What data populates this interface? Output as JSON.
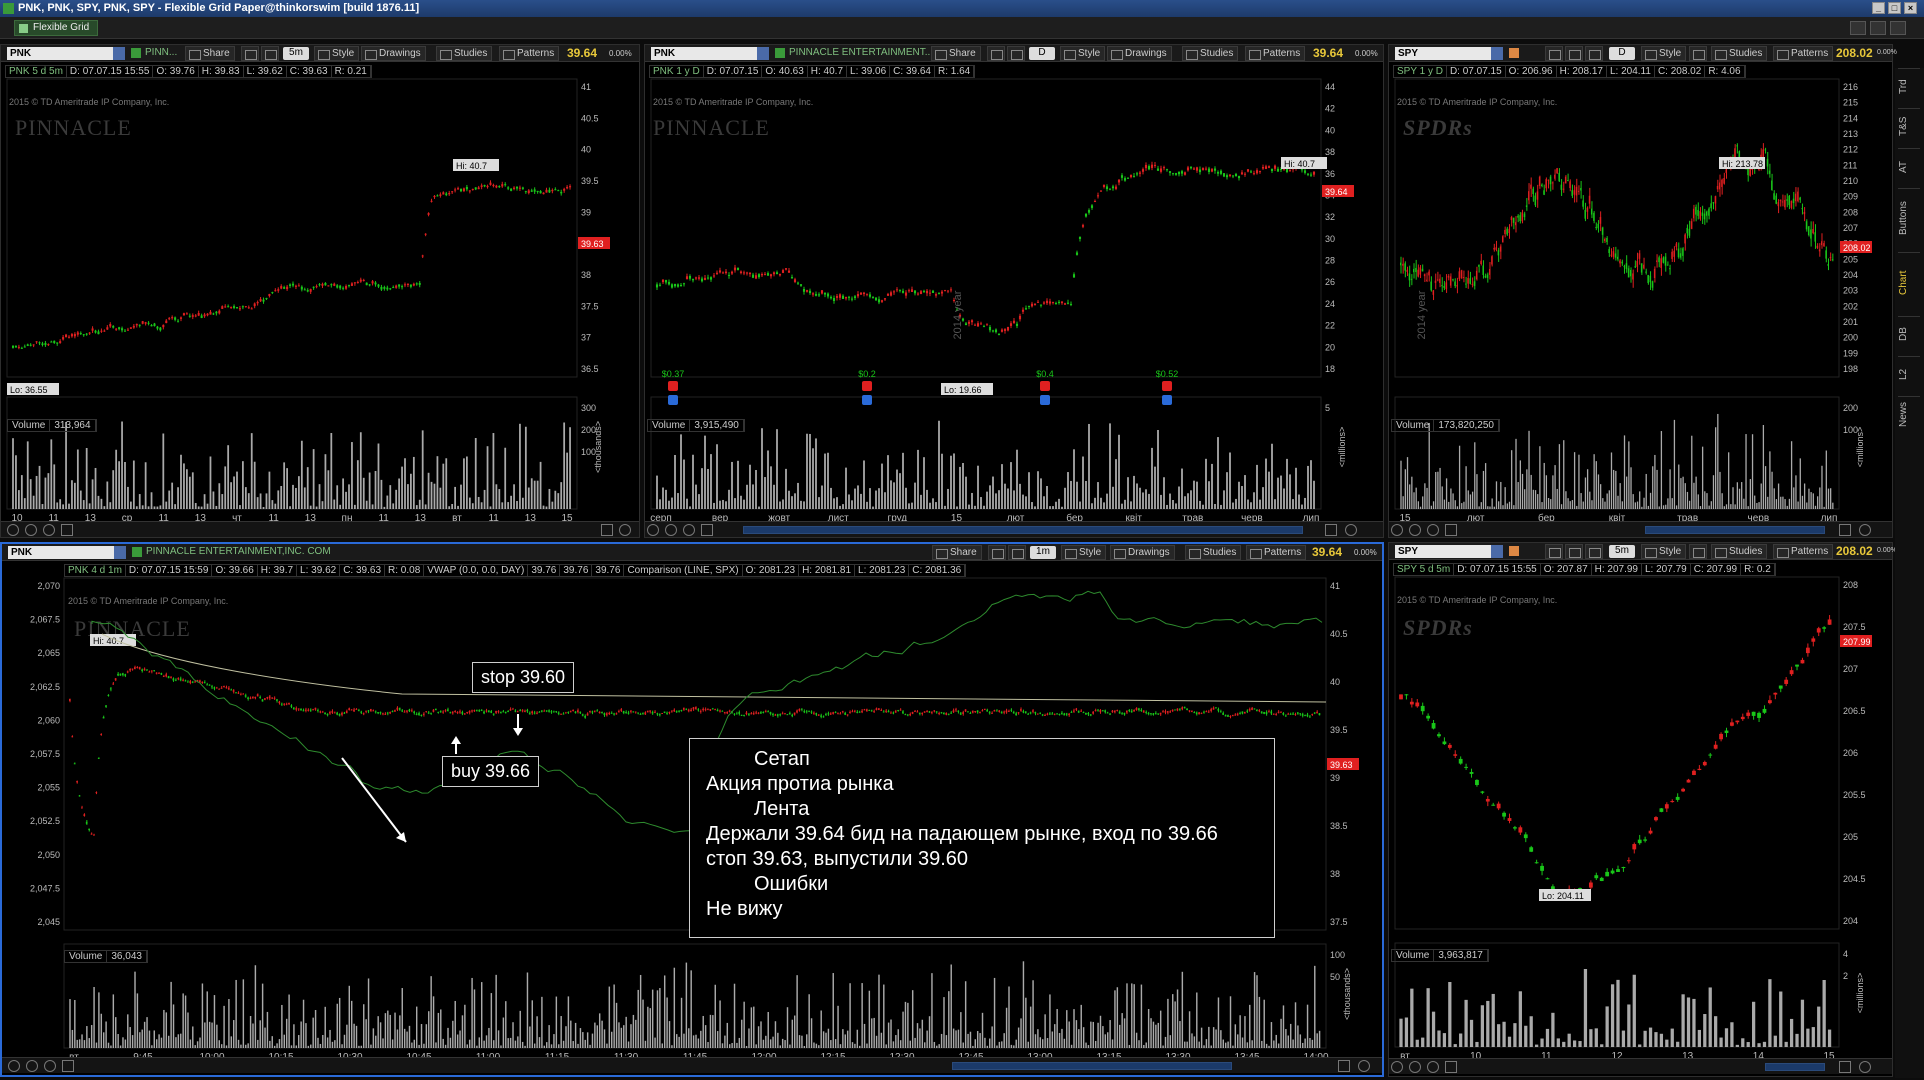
{
  "window": {
    "title": "PNK, PNK, SPY, PNK, SPY - Flexible Grid Paper@thinkorswim [build 1876.11]"
  },
  "menubar": {
    "grid_label": "Flexible Grid"
  },
  "toolbar": {
    "share": "Share",
    "style": "Style",
    "drawings": "Drawings",
    "studies": "Studies",
    "patterns": "Patterns"
  },
  "sidebar": {
    "tabs": [
      "Trd",
      "T&S",
      "AT",
      "Buttons",
      "Chart",
      "DB",
      "L2",
      "News"
    ],
    "selected": "Chart"
  },
  "panels": {
    "p1": {
      "symbol": "PNK",
      "company": "PINN...",
      "timeframe": "5m",
      "price": "39.64",
      "change": "0.00%",
      "info": [
        "PNK 5 d 5m",
        "D: 07.07.15 15:55",
        "O: 39.76",
        "H: 39.83",
        "L: 39.62",
        "C: 39.63",
        "R: 0.21"
      ],
      "copyright": "2015 © TD Ameritrade IP Company, Inc.",
      "watermark": "PINNACLE",
      "hi": "Hi: 40.7",
      "lo": "Lo: 36.55",
      "last": "39.63",
      "yticks": [
        "41",
        "40.5",
        "40",
        "39.5",
        "39",
        "38.5",
        "38",
        "37.5",
        "37",
        "36.5"
      ],
      "volume": "313,964",
      "vol_ticks": [
        "300",
        "200",
        "100"
      ],
      "vol_unit": "<thousands>",
      "xticks": [
        "10",
        "11",
        "13",
        "ср",
        "11",
        "13",
        "чт",
        "11",
        "13",
        "пн",
        "11",
        "13",
        "вт",
        "11",
        "13",
        "15"
      ]
    },
    "p2": {
      "symbol": "PNK",
      "company": "PINNACLE ENTERTAINMENT...",
      "timeframe": "D",
      "price": "39.64",
      "change": "0.00%",
      "info": [
        "PNK 1 y D",
        "D: 07.07.15",
        "O: 40.63",
        "H: 40.7",
        "L: 39.06",
        "C: 39.64",
        "R: 1.64"
      ],
      "copyright": "2015 © TD Ameritrade IP Company, Inc.",
      "watermark": "PINNACLE",
      "hi": "Hi: 40.7",
      "lo": "Lo: 19.66",
      "last": "39.64",
      "dividends": [
        "$0.37",
        "$0.2",
        "$0.4",
        "$0.52"
      ],
      "year_label": "2014 year",
      "yticks": [
        "44",
        "42",
        "40",
        "38",
        "36",
        "34",
        "32",
        "30",
        "28",
        "26",
        "24",
        "22",
        "20",
        "18"
      ],
      "volume": "3,915,490",
      "vol_ticks": [
        "5"
      ],
      "vol_unit": "<millions>",
      "xticks": [
        "серп",
        "вер",
        "жовт",
        "лист",
        "груд",
        "15",
        "лют",
        "бер",
        "квіт",
        "трав",
        "черв",
        "лип"
      ]
    },
    "p3": {
      "symbol": "SPY",
      "timeframe": "D",
      "price": "208.02",
      "change": "0.00%",
      "info": [
        "SPY 1 y D",
        "D: 07.07.15",
        "O: 206.96",
        "H: 208.17",
        "L: 204.11",
        "C: 208.02",
        "R: 4.06"
      ],
      "copyright": "2015 © TD Ameritrade IP Company, Inc.",
      "watermark": "SPDRs",
      "hi": "Hi: 213.78",
      "last": "208.02",
      "year_label": "2014 year",
      "yticks": [
        "216",
        "215",
        "214",
        "213",
        "212",
        "211",
        "210",
        "209",
        "208",
        "207",
        "206",
        "205",
        "204",
        "203",
        "202",
        "201",
        "200",
        "199",
        "198"
      ],
      "volume": "173,820,250",
      "vol_ticks": [
        "200",
        "100"
      ],
      "vol_unit": "<millions>",
      "xticks": [
        "15",
        "лют",
        "бер",
        "квіт",
        "трав",
        "черв",
        "лип"
      ]
    },
    "p4": {
      "symbol": "PNK",
      "company": "PINNACLE ENTERTAINMENT,INC. COM",
      "timeframe": "1m",
      "price": "39.64",
      "change": "0.00%",
      "info": [
        "PNK 4 d 1m",
        "D: 07.07.15 15:59",
        "O: 39.66",
        "H: 39.7",
        "L: 39.62",
        "C: 39.63",
        "R: 0.08",
        "VWAP (0.0, 0.0, DAY)",
        "39.76",
        "39.76",
        "39.76",
        "Comparison (LINE, SPX)",
        "O: 2081.23",
        "H: 2081.81",
        "L: 2081.23",
        "C: 2081.36"
      ],
      "copyright": "2015 © TD Ameritrade IP Company, Inc.",
      "watermark": "PINNACLE",
      "hi": "Hi: 40.7",
      "last": "39.63",
      "yticks_left": [
        "2,070",
        "2,067.5",
        "2,065",
        "2,062.5",
        "2,060",
        "2,057.5",
        "2,055",
        "2,052.5",
        "2,050",
        "2,047.5",
        "2,045"
      ],
      "yticks_right": [
        "41",
        "40.5",
        "40",
        "39.5",
        "39",
        "38.5",
        "38",
        "37.5"
      ],
      "volume": "36,043",
      "vol_ticks": [
        "100",
        "50"
      ],
      "vol_unit": "<thousands>",
      "xticks": [
        "вт",
        "9:45",
        "10:00",
        "10:15",
        "10:30",
        "10:45",
        "11:00",
        "11:15",
        "11:30",
        "11:45",
        "12:00",
        "12:15",
        "12:30",
        "12:45",
        "13:00",
        "13:15",
        "13:30",
        "13:45",
        "14:00"
      ]
    },
    "p5": {
      "symbol": "SPY",
      "timeframe": "5m",
      "price": "208.02",
      "change": "0.00%",
      "info": [
        "SPY 5 d 5m",
        "D: 07.07.15 15:55",
        "O: 207.87",
        "H: 207.99",
        "L: 207.79",
        "C: 207.99",
        "R: 0.2"
      ],
      "copyright": "2015 © TD Ameritrade IP Company, Inc.",
      "watermark": "SPDRs",
      "lo": "Lo: 204.11",
      "last": "207.99",
      "yticks": [
        "208",
        "207.5",
        "207",
        "206.5",
        "206",
        "205.5",
        "205",
        "204.5",
        "204"
      ],
      "volume": "3,963,817",
      "vol_ticks": [
        "4",
        "2"
      ],
      "vol_unit": "<millions>",
      "xticks": [
        "вт",
        "10",
        "11",
        "12",
        "13",
        "14",
        "15"
      ]
    }
  },
  "annotations": {
    "stop": "stop 39.60",
    "buy": "buy 39.66"
  },
  "note": {
    "lines": [
      "Сетап",
      "Акция протиа рынка",
      "Лента",
      "Держали 39.64 бид на падающем рынке, вход по 39.66 стоп 39.63, выпустили 39.60",
      "Ошибки",
      "Не вижу"
    ]
  }
}
